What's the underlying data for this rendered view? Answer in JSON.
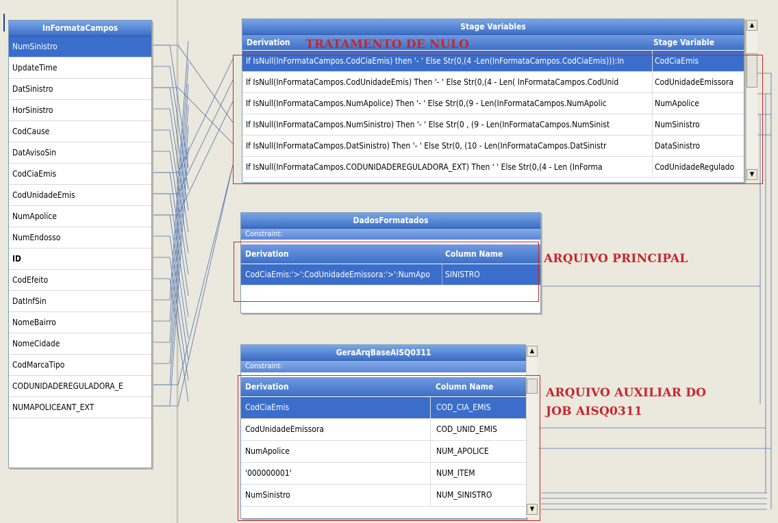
{
  "left_table": {
    "title": "InFormataCampos",
    "selected_index": 0,
    "fields": [
      "NumSinistro",
      "UpdateTime",
      "DatSinistro",
      "HorSinistro",
      "CodCause",
      "DatAvisoSin",
      "CodCiaEmis",
      "CodUnidadeEmis",
      "NumApolice",
      "NumEndosso",
      "ID",
      "CodEfeito",
      "DatInfSin",
      "NomeBairro",
      "NomeCidade",
      "CodMarcaTipo",
      "CODUNIDADEREGULADORA_E",
      "NUMAPOLICEANT_EXT"
    ]
  },
  "stage_variables": {
    "title": "Stage Variables",
    "col_derivation": "Derivation",
    "col_stage_variable": "Stage Variable",
    "rows": [
      {
        "derivation": "If IsNull(InFormataCampos.CodCiaEmis) then '-   ' Else Str(0,(4 -Len(InFormataCampos.CodCiaEmis))):In",
        "variable": "CodCiaEmis"
      },
      {
        "derivation": "If IsNull(InFormataCampos.CodUnidadeEmis) Then '-   ' Else Str(0,(4 - Len( InFormataCampos.CodUnid",
        "variable": "CodUnidadeEmissora"
      },
      {
        "derivation": "If IsNull(InFormataCampos.NumApolice) Then '-           ' Else Str(0,(9 - Len(InFormataCampos.NumApolic",
        "variable": "NumApolice"
      },
      {
        "derivation": "If IsNull(InFormataCampos.NumSinistro) Then '-          ' Else Str(0 , (9 - Len(InFormataCampos.NumSinist",
        "variable": "NumSinistro"
      },
      {
        "derivation": "If IsNull(InFormataCampos.DatSinistro) Then '-          ' Else Str(0, (10 - Len(InFormataCampos.DatSinistr",
        "variable": "DataSinistro"
      },
      {
        "derivation": "If IsNull(InFormataCampos.CODUNIDADEREGULADORA_EXT) Then '   ' Else Str(0,(4 - Len (InForma",
        "variable": "CodUnidadeRegulado"
      }
    ]
  },
  "dados_formatados": {
    "title": "DadosFormatados",
    "constraint_label": "Constraint:",
    "col_derivation": "Derivation",
    "col_name": "Column Name",
    "rows": [
      {
        "derivation": "CodCiaEmis:'>':CodUnidadeEmissora:'>':NumApo",
        "column": "SINISTRO"
      }
    ]
  },
  "gera_arq": {
    "title": "GeraArqBaseAISQ0311",
    "constraint_label": "Constraint:",
    "col_derivation": "Derivation",
    "col_name": "Column Name",
    "rows": [
      {
        "derivation": "CodCiaEmis",
        "column": "COD_CIA_EMIS"
      },
      {
        "derivation": "CodUnidadeEmissora",
        "column": "COD_UNID_EMIS"
      },
      {
        "derivation": "NumApolice",
        "column": "NUM_APOLICE"
      },
      {
        "derivation": "'000000001'",
        "column": "NUM_ITEM"
      },
      {
        "derivation": "NumSinistro",
        "column": "NUM_SINISTRO"
      }
    ]
  },
  "annotations": {
    "nulo": "TRATAMENTO DE NULO",
    "principal": "ARQUIVO PRINCIPAL",
    "auxiliar_line1": "ARQUIVO AUXILIAR DO",
    "auxiliar_line2": "JOB AISQ0311"
  },
  "colors": {
    "selection": "#3b6ecb",
    "annotation_red": "#c8242c",
    "link_lines": "#4a6fae"
  },
  "icons": {
    "scroll_up": "▲",
    "scroll_down": "▼"
  }
}
